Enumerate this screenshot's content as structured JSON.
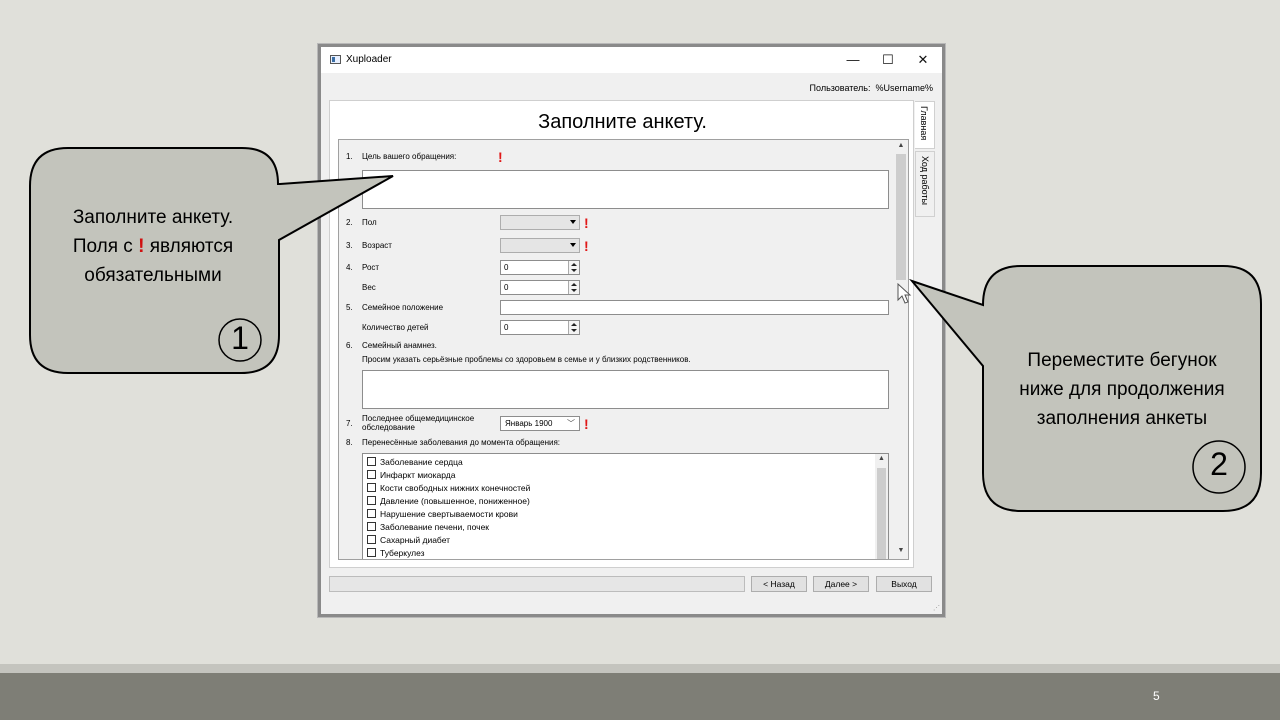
{
  "window": {
    "title": "Xuploader",
    "minimize_glyph": "—",
    "maximize_glyph": "☐",
    "close_glyph": "✕",
    "user_label": "Пользователь:",
    "user_name": "%Username%"
  },
  "tabs": [
    "Главная",
    "Ход работы"
  ],
  "form": {
    "title": "Заполните анкету.",
    "required_mark": "!",
    "q1": {
      "num": "1.",
      "label": "Цель вашего обращения:"
    },
    "q2": {
      "num": "2.",
      "label": "Пол"
    },
    "q3": {
      "num": "3.",
      "label": "Возраст"
    },
    "q4": {
      "num": "4.",
      "label": "Рост",
      "value": "0"
    },
    "q4b": {
      "label": "Вес",
      "value": "0"
    },
    "q5": {
      "num": "5.",
      "label": "Семейное положение"
    },
    "q5b": {
      "label": "Количество детей",
      "value": "0"
    },
    "q6": {
      "num": "6.",
      "label": "Семейный анамнез.",
      "hint": "Просим указать серьёзные проблемы со здоровьем в семье и у близких родственников."
    },
    "q7": {
      "num": "7.",
      "label_line1": "Последнее общемедицинское",
      "label_line2": "обследование",
      "value": "Январь 1900"
    },
    "q8": {
      "num": "8.",
      "label": "Перенесённые заболевания до момента обращения:"
    },
    "diseases": [
      "Заболевание сердца",
      "Инфаркт миокарда",
      "Кости свободных нижних конечностей",
      "Давление (повышенное, пониженное)",
      "Нарушение свертываемости крови",
      "Заболевание печени, почек",
      "Сахарный диабет",
      "Туберкулез"
    ]
  },
  "buttons": {
    "back": "< Назад",
    "next": "Далее >",
    "exit": "Выход"
  },
  "callouts": {
    "left": {
      "line1": "Заполните анкету.",
      "line2_pre": "Поля с ",
      "line2_mark": "!",
      "line2_post": " являются",
      "line3": "обязательными",
      "number": "1"
    },
    "right": {
      "line1": "Переместите бегунок",
      "line2": "ниже для продолжения",
      "line3": "заполнения анкеты",
      "number": "2"
    }
  },
  "slide": {
    "page_number": "5"
  },
  "colors": {
    "required": "#e01818",
    "callout_fill": "#c3c4bc",
    "footer": "#7e7e76"
  }
}
